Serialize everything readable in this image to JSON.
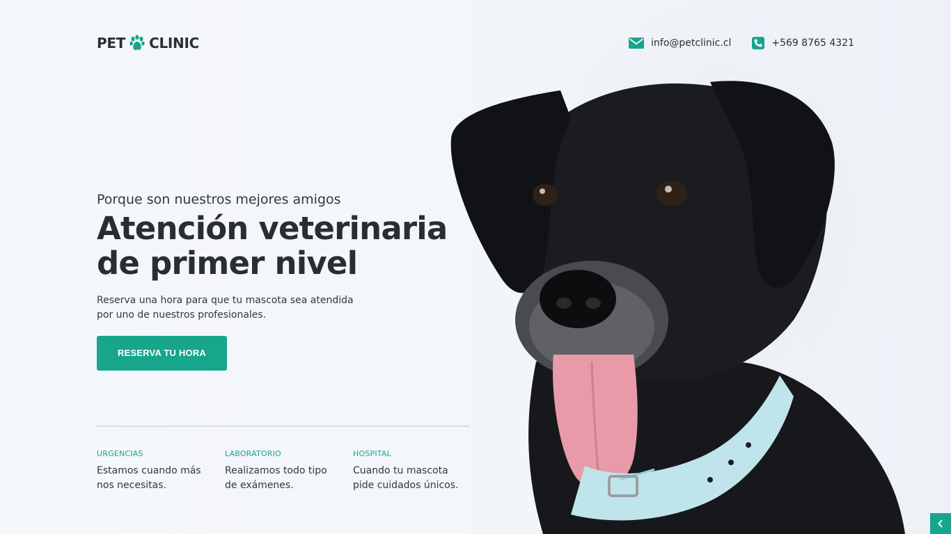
{
  "header": {
    "logo_left": "PET",
    "logo_right": "CLINIC",
    "email": "info@petclinic.cl",
    "phone": "+569 8765 4321"
  },
  "hero": {
    "kicker": "Porque son nuestros mejores amigos",
    "title_line1": "Atención veterinaria",
    "title_line2": "de primer nivel",
    "lead_line1": "Reserva una hora para que tu mascota sea atendida",
    "lead_line2": "por uno de nuestros profesionales.",
    "cta_label": "RESERVA TU HORA"
  },
  "features": [
    {
      "title": "URGENCIAS",
      "desc": "Estamos cuando más nos necesitas."
    },
    {
      "title": "LABORATORIO",
      "desc": "Realizamos todo tipo de exámenes."
    },
    {
      "title": "HOSPITAL",
      "desc": "Cuando tu mascota pide cuidados únicos."
    }
  ],
  "colors": {
    "accent": "#17a58c",
    "text": "#2b2f33",
    "background": "#f3f6fb"
  },
  "icons": {
    "logo": "paw-icon",
    "email": "envelope-icon",
    "phone": "phone-icon",
    "side": "chevron-left-icon"
  }
}
